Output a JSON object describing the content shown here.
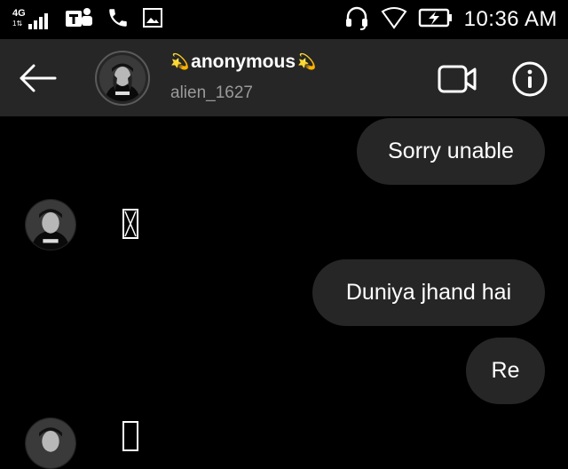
{
  "status_bar": {
    "network_label": "4G",
    "network_sub": "1⇅",
    "icons": [
      "signal-icon",
      "teams-icon",
      "phone-icon",
      "gallery-icon",
      "headset-icon",
      "wifi-icon",
      "battery-charging-icon"
    ],
    "time": "10:36 AM"
  },
  "header": {
    "back_icon": "arrow-left-icon",
    "name_decoration": "💫",
    "name": "anonymous",
    "handle": "alien_1627",
    "video_icon": "video-camera-icon",
    "info_icon": "info-icon"
  },
  "messages": [
    {
      "side": "sent",
      "text": "Sorry unable"
    },
    {
      "side": "received",
      "text": ""
    },
    {
      "side": "sent",
      "text": "Duniya jhand hai"
    },
    {
      "side": "sent",
      "text": "Re"
    },
    {
      "side": "received",
      "text": ""
    }
  ],
  "colors": {
    "background": "#000000",
    "header_bg": "#262626",
    "bubble_bg": "#262626",
    "text": "#ffffff",
    "handle_text": "#9a9a9a"
  }
}
